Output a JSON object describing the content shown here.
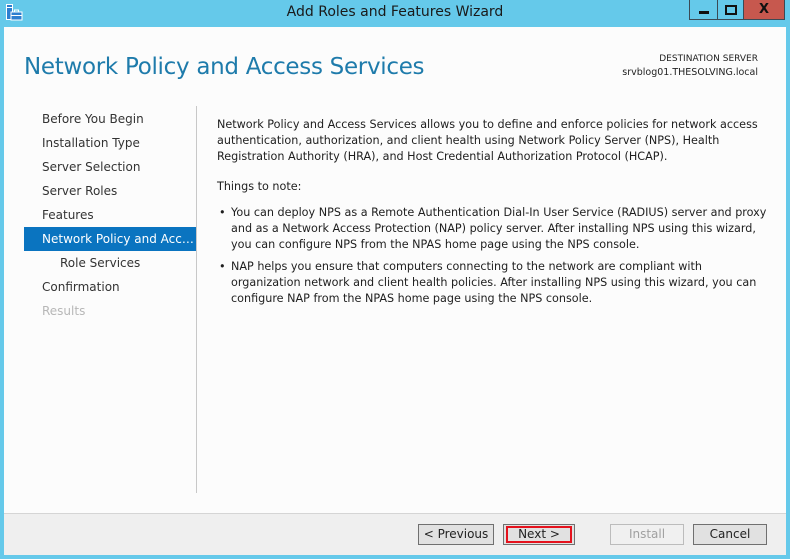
{
  "window": {
    "title": "Add Roles and Features Wizard",
    "app_icon": "server-manager-icon",
    "controls": {
      "minimize": "minimize-icon",
      "maximize": "maximize-icon",
      "close": "X"
    }
  },
  "header": {
    "page_title": "Network Policy and Access Services",
    "destination_label": "DESTINATION SERVER",
    "destination_value": "srvblog01.THESOLVING.local"
  },
  "nav": {
    "items": [
      {
        "label": "Before You Begin",
        "state": "normal"
      },
      {
        "label": "Installation Type",
        "state": "normal"
      },
      {
        "label": "Server Selection",
        "state": "normal"
      },
      {
        "label": "Server Roles",
        "state": "normal"
      },
      {
        "label": "Features",
        "state": "normal"
      },
      {
        "label": "Network Policy and Access Services",
        "state": "active"
      },
      {
        "label": "Role Services",
        "state": "sub"
      },
      {
        "label": "Confirmation",
        "state": "normal"
      },
      {
        "label": "Results",
        "state": "disabled"
      }
    ]
  },
  "content": {
    "intro": "Network Policy and Access Services allows you to define and enforce policies for network access authentication, authorization, and client health using Network Policy Server (NPS), Health Registration Authority (HRA), and Host Credential Authorization Protocol (HCAP).",
    "notes_title": "Things to note:",
    "notes": [
      "You can deploy NPS as a Remote Authentication Dial-In User Service (RADIUS) server and proxy and as a Network Access Protection (NAP) policy server. After installing NPS using this wizard, you can configure NPS from the NPAS home page using the NPS console.",
      "NAP helps you ensure that computers connecting to the network are compliant with organization network and client health policies. After installing NPS using this wizard, you can configure NAP from the NPAS home page using the NPS console."
    ]
  },
  "footer": {
    "previous_label": "< Previous",
    "next_label": "Next >",
    "install_label": "Install",
    "cancel_label": "Cancel",
    "highlight_color": "#e5121d"
  }
}
